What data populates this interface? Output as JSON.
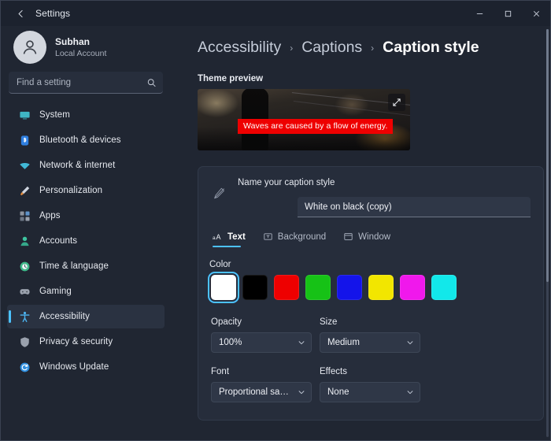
{
  "window": {
    "title": "Settings",
    "back_icon": "back-arrow-icon",
    "minimize_label": "–",
    "maximize_label": "□",
    "close_label": "×"
  },
  "account": {
    "name": "Subhan",
    "subtitle": "Local Account",
    "avatar_icon": "person-avatar-icon"
  },
  "search": {
    "placeholder": "Find a setting",
    "value": "",
    "icon": "search-icon"
  },
  "sidebar": {
    "items": [
      {
        "label": "System",
        "icon": "monitor-icon",
        "color": "#3fb6c4",
        "selected": false
      },
      {
        "label": "Bluetooth & devices",
        "icon": "bluetooth-icon",
        "color": "#2f7fe0",
        "selected": false
      },
      {
        "label": "Network & internet",
        "icon": "network-icon",
        "color": "#41b8d6",
        "selected": false
      },
      {
        "label": "Personalization",
        "icon": "brush-icon",
        "color": "#e08a3c",
        "selected": false
      },
      {
        "label": "Apps",
        "icon": "apps-icon",
        "color": "#8d949f",
        "selected": false
      },
      {
        "label": "Accounts",
        "icon": "accounts-icon",
        "color": "#3ec4a0",
        "selected": false
      },
      {
        "label": "Time & language",
        "icon": "clock-icon",
        "color": "#3fb98a",
        "selected": false
      },
      {
        "label": "Gaming",
        "icon": "gamepad-icon",
        "color": "#9aa1ad",
        "selected": false
      },
      {
        "label": "Accessibility",
        "icon": "accessibility-icon",
        "color": "#4cb3ef",
        "selected": true
      },
      {
        "label": "Privacy & security",
        "icon": "shield-icon",
        "color": "#9aa1ad",
        "selected": false
      },
      {
        "label": "Windows Update",
        "icon": "update-icon",
        "color": "#2f8fe0",
        "selected": false
      }
    ]
  },
  "breadcrumb": {
    "items": [
      "Accessibility",
      "Captions",
      "Caption style"
    ],
    "separator": "›"
  },
  "preview": {
    "section_label": "Theme preview",
    "caption_text": "Waves are caused by a flow of energy.",
    "caption_bg": "#ee0000",
    "caption_fg": "#ffffff",
    "expand_icon": "expand-diagonal-icon"
  },
  "style_card": {
    "edit_icon": "pen-edit-icon",
    "name_label": "Name your caption style",
    "name_value": "White on black (copy)",
    "name_placeholder": "Name your caption style",
    "tabs": [
      {
        "label": "Text",
        "icon": "text-format-icon",
        "active": true
      },
      {
        "label": "Background",
        "icon": "background-icon",
        "active": false
      },
      {
        "label": "Window",
        "icon": "window-icon",
        "active": false
      }
    ],
    "color": {
      "label": "Color",
      "swatches": [
        {
          "name": "white",
          "hex": "#ffffff",
          "selected": true
        },
        {
          "name": "black",
          "hex": "#000000",
          "selected": false
        },
        {
          "name": "red",
          "hex": "#ee0000",
          "selected": false
        },
        {
          "name": "green",
          "hex": "#16c216",
          "selected": false
        },
        {
          "name": "blue",
          "hex": "#1414ea",
          "selected": false
        },
        {
          "name": "yellow",
          "hex": "#f2e600",
          "selected": false
        },
        {
          "name": "magenta",
          "hex": "#f018ec",
          "selected": false
        },
        {
          "name": "cyan",
          "hex": "#12e8ea",
          "selected": false
        }
      ]
    },
    "opacity": {
      "label": "Opacity",
      "value": "100%"
    },
    "size": {
      "label": "Size",
      "value": "Medium"
    },
    "font": {
      "label": "Font",
      "value": "Proportional sans s..."
    },
    "effects": {
      "label": "Effects",
      "value": "None"
    },
    "accent_color": "#4cc2ff"
  }
}
